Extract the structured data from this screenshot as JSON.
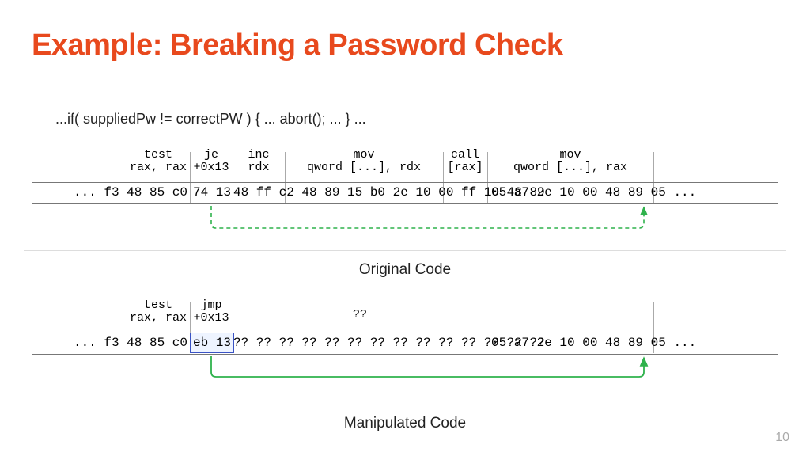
{
  "title": "Example: Breaking a Password Check",
  "source_line": "...if( suppliedPw != correctPW ) { ... abort(); ... } ...",
  "caption_original": "Original Code",
  "caption_manipulated": "Manipulated Code",
  "page_number": "10",
  "colors": {
    "accent": "#e8491d",
    "arrow": "#2fb24c",
    "highlight_border": "#3a53c4"
  },
  "original": {
    "labels": [
      {
        "top": "test",
        "bottom": "rax, rax"
      },
      {
        "top": "je",
        "bottom": "+0x13"
      },
      {
        "top": "inc",
        "bottom": "rdx"
      },
      {
        "top": "mov",
        "bottom": "qword [...], rdx"
      },
      {
        "top": "call",
        "bottom": "[rax]"
      },
      {
        "top": "mov",
        "bottom": "qword [...], rax"
      }
    ],
    "bytes": {
      "pre": "... f3 48 85 c0",
      "je": "74 13",
      "body": "48 ff c2 48 89 15 b0 2e 10 00 ff 10 48 89",
      "post": "05 a7 2e 10 00 48 89 05 ..."
    }
  },
  "manipulated": {
    "labels": [
      {
        "top": "test",
        "bottom": "rax, rax"
      },
      {
        "top": "jmp",
        "bottom": "+0x13"
      },
      {
        "top": "",
        "bottom": "??"
      }
    ],
    "bytes": {
      "pre": "... f3 48 85 c0",
      "jmp": "eb 13",
      "body": "?? ?? ?? ?? ?? ?? ?? ?? ?? ?? ?? ?? ?? ??",
      "post": "05 a7 2e 10 00 48 89 05 ..."
    }
  }
}
